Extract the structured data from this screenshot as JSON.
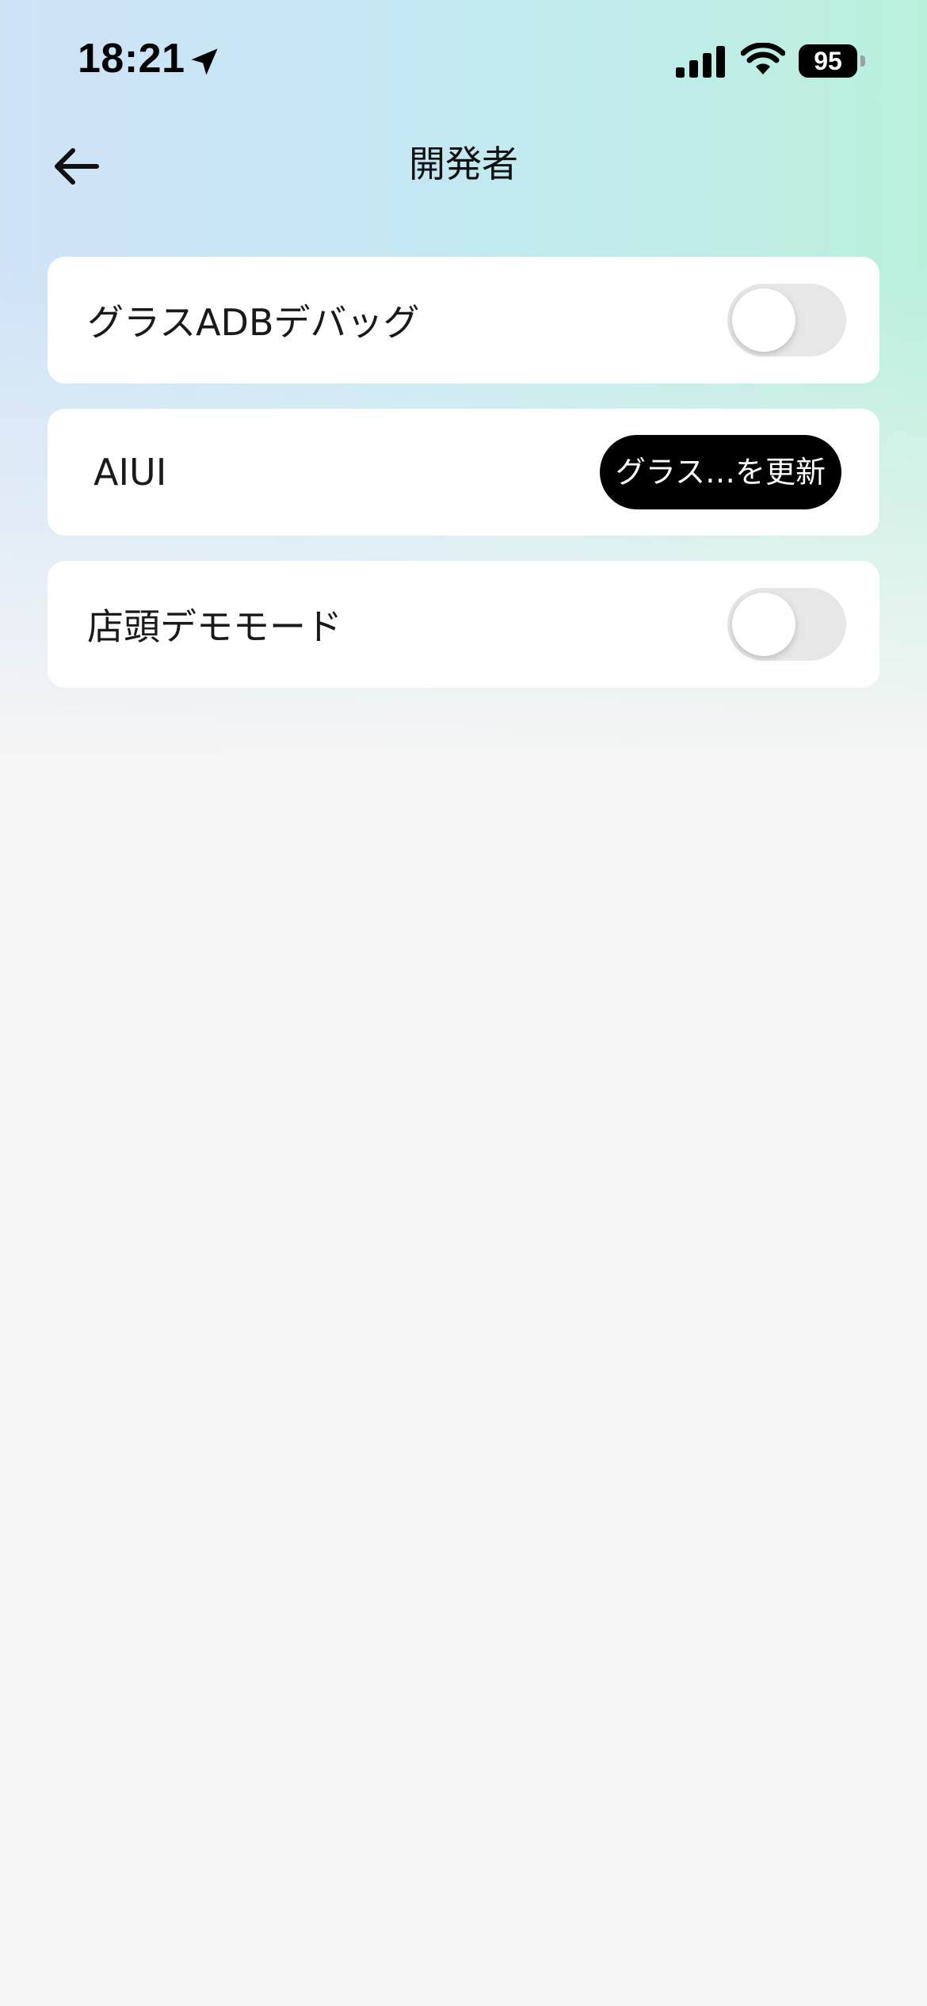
{
  "status_bar": {
    "time": "18:21",
    "battery_level": "95",
    "icons": [
      "location-arrow-icon",
      "cellular-signal-icon",
      "wifi-icon",
      "battery-icon"
    ]
  },
  "header": {
    "title": "開発者",
    "back_icon": "arrow-left-icon"
  },
  "settings": {
    "glass_adb": {
      "label": "グラスADBデバッグ",
      "toggle_on": false
    },
    "aiui": {
      "label": "AIUI",
      "button_label": "グラス…を更新"
    },
    "store_demo": {
      "label": "店頭デモモード",
      "toggle_on": false
    }
  },
  "colors": {
    "gradient_left": "#cfe3f7",
    "gradient_right": "#b9f0dc",
    "background": "#f5f5f5",
    "card": "#ffffff",
    "toggle_off_track": "#e6e6e6",
    "button": "#000000"
  }
}
